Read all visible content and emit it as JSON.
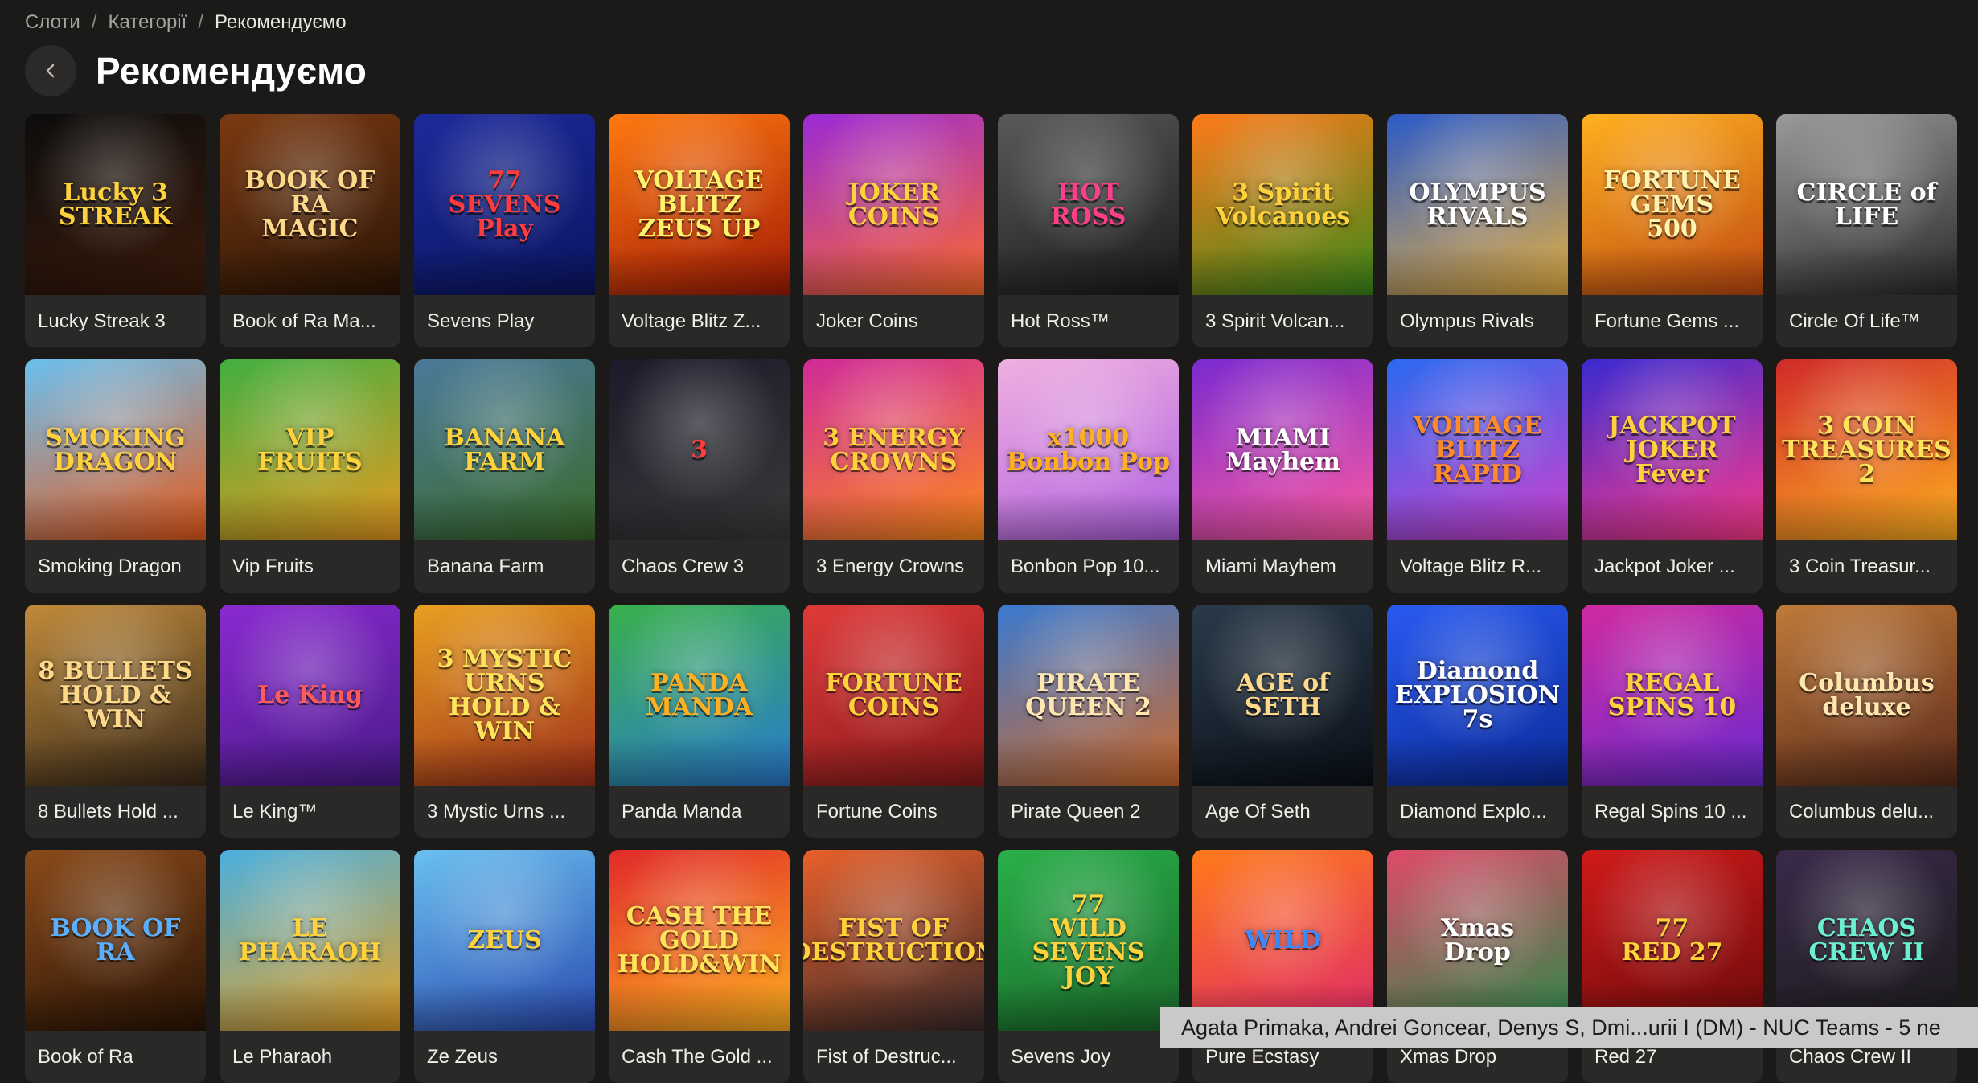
{
  "breadcrumb": {
    "items": [
      "Слоти",
      "Категорії"
    ],
    "separator": "/",
    "current": "Рекомендуємо"
  },
  "header": {
    "title": "Рекомендуємо"
  },
  "games": [
    {
      "title": "Lucky Streak 3",
      "logo": "Lucky 3\nSTREAK",
      "colors": [
        "#0d0d0d",
        "#3a1a0a"
      ],
      "logo_color": "#ffd23b"
    },
    {
      "title": "Book of Ra Ma...",
      "logo": "BOOK OF RA\nMAGIC",
      "colors": [
        "#7b3a12",
        "#2a1405"
      ],
      "logo_color": "#ffd98a"
    },
    {
      "title": "Sevens Play",
      "logo": "77\nSEVENS\nPlay",
      "colors": [
        "#1d2a9c",
        "#0a1560"
      ],
      "logo_color": "#ff3b3b"
    },
    {
      "title": "Voltage Blitz Z...",
      "logo": "VOLTAGE BLITZ\nZEUS UP",
      "colors": [
        "#ff7a10",
        "#a31a05"
      ],
      "logo_color": "#fff36b"
    },
    {
      "title": "Joker Coins",
      "logo": "JOKER\nCOINS",
      "colors": [
        "#9a2ad6",
        "#ff6a2a"
      ],
      "logo_color": "#ffd23b"
    },
    {
      "title": "Hot Ross™",
      "logo": "HOT\nROSS",
      "colors": [
        "#5a5a5a",
        "#1a1a1a"
      ],
      "logo_color": "#ff3d8a"
    },
    {
      "title": "3 Spirit Volcan...",
      "logo": "3 Spirit\nVolcanoes",
      "colors": [
        "#ff7a1a",
        "#3a8a1a"
      ],
      "logo_color": "#ffd23b"
    },
    {
      "title": "Olympus Rivals",
      "logo": "OLYMPUS\nRIVALS",
      "colors": [
        "#2a5ac8",
        "#e8b040"
      ],
      "logo_color": "#ffffff"
    },
    {
      "title": "Fortune Gems ...",
      "logo": "FORTUNE GEMS\n500",
      "colors": [
        "#ffb020",
        "#c04a10"
      ],
      "logo_color": "#fff3b0"
    },
    {
      "title": "Circle Of Life™",
      "logo": "CIRCLE of LIFE",
      "colors": [
        "#9a9a9a",
        "#2a2a2a"
      ],
      "logo_color": "#ffffff"
    },
    {
      "title": "Smoking Dragon",
      "logo": "SMOKING\nDRAGON",
      "colors": [
        "#6ac0f0",
        "#e85a1a"
      ],
      "logo_color": "#ffd23b"
    },
    {
      "title": "Vip Fruits",
      "logo": "VIP\nFRUITS",
      "colors": [
        "#40b040",
        "#e89a20"
      ],
      "logo_color": "#ffd23b"
    },
    {
      "title": "Banana Farm",
      "logo": "BANANA\nFARM",
      "colors": [
        "#4a7a9a",
        "#3a6a2a"
      ],
      "logo_color": "#ffd23b"
    },
    {
      "title": "Chaos Crew 3",
      "logo": "3",
      "colors": [
        "#1a1a2a",
        "#3a3a3a"
      ],
      "logo_color": "#ff3d3d"
    },
    {
      "title": "3 Energy Crowns",
      "logo": "3 ENERGY\nCROWNS",
      "colors": [
        "#d02a9a",
        "#ff8a1a"
      ],
      "logo_color": "#ffd23b"
    },
    {
      "title": "Bonbon Pop 10...",
      "logo": "x1000\nBonbon Pop",
      "colors": [
        "#f0b0e0",
        "#b060e0"
      ],
      "logo_color": "#ffb020"
    },
    {
      "title": "Miami Mayhem",
      "logo": "MIAMI\nMayhem",
      "colors": [
        "#7a2ad0",
        "#ff5aa0"
      ],
      "logo_color": "#ffffff"
    },
    {
      "title": "Voltage Blitz R...",
      "logo": "VOLTAGE BLITZ\nRAPID",
      "colors": [
        "#2a6af0",
        "#d040d0"
      ],
      "logo_color": "#ff8a2a"
    },
    {
      "title": "Jackpot Joker ...",
      "logo": "JACKPOT JOKER\nFever",
      "colors": [
        "#3a2ad0",
        "#ff3a8a"
      ],
      "logo_color": "#ffd23b"
    },
    {
      "title": "3 Coin Treasur...",
      "logo": "3 COIN\nTREASURES 2",
      "colors": [
        "#d02a2a",
        "#ffb020"
      ],
      "logo_color": "#ffe35b"
    },
    {
      "title": "8 Bullets Hold ...",
      "logo": "8 BULLETS\nHOLD & WIN",
      "colors": [
        "#c08a3a",
        "#3a2a1a"
      ],
      "logo_color": "#ffd98a"
    },
    {
      "title": "Le King™",
      "logo": "Le King",
      "colors": [
        "#8a2ad0",
        "#4a1a8a"
      ],
      "logo_color": "#ff5a5a"
    },
    {
      "title": "3 Mystic Urns ...",
      "logo": "3 MYSTIC URNS\nHOLD & WIN",
      "colors": [
        "#e8a020",
        "#a0301a"
      ],
      "logo_color": "#ffe35b"
    },
    {
      "title": "Panda Manda",
      "logo": "PANDA\nMANDA",
      "colors": [
        "#3ab04a",
        "#2a7ad0"
      ],
      "logo_color": "#ffb020"
    },
    {
      "title": "Fortune Coins",
      "logo": "FORTUNE\nCOINS",
      "colors": [
        "#e03a3a",
        "#8a1a1a"
      ],
      "logo_color": "#ffd23b"
    },
    {
      "title": "Pirate Queen 2",
      "logo": "PIRATE\nQUEEN 2",
      "colors": [
        "#3a7ad0",
        "#d06a2a"
      ],
      "logo_color": "#ffe8b0"
    },
    {
      "title": "Age Of Seth",
      "logo": "AGE of\nSETH",
      "colors": [
        "#2a3a4a",
        "#0a1018"
      ],
      "logo_color": "#ffd98a"
    },
    {
      "title": "Diamond Explo...",
      "logo": "Diamond\nEXPLOSION 7s",
      "colors": [
        "#2a5af0",
        "#0a2a9a"
      ],
      "logo_color": "#ffffff"
    },
    {
      "title": "Regal Spins 10 ...",
      "logo": "REGAL\nSPINS 10",
      "colors": [
        "#d02aa0",
        "#6a2ad0"
      ],
      "logo_color": "#ffd23b"
    },
    {
      "title": "Columbus delu...",
      "logo": "Columbus\ndeluxe",
      "colors": [
        "#c07a3a",
        "#5a2a1a"
      ],
      "logo_color": "#ffe8b0"
    },
    {
      "title": "Book of Ra",
      "logo": "BOOK OF RA",
      "colors": [
        "#8a4a1a",
        "#2a1405"
      ],
      "logo_color": "#5ab0ff"
    },
    {
      "title": "Le Pharaoh",
      "logo": "LE PHARAOH",
      "colors": [
        "#4ab0e0",
        "#e8a020"
      ],
      "logo_color": "#ffd23b"
    },
    {
      "title": "Ze Zeus",
      "logo": "ZEUS",
      "colors": [
        "#6ac0f0",
        "#2a4ab0"
      ],
      "logo_color": "#ffd23b"
    },
    {
      "title": "Cash The Gold ...",
      "logo": "CASH THE GOLD\nHOLD&WIN",
      "colors": [
        "#e02a2a",
        "#ffb020"
      ],
      "logo_color": "#ffe35b"
    },
    {
      "title": "Fist of Destruc...",
      "logo": "FIST OF\nDESTRUCTION",
      "colors": [
        "#e8602a",
        "#3a2a2a"
      ],
      "logo_color": "#ffd23b"
    },
    {
      "title": "Sevens Joy",
      "logo": "77\nWILD\nSEVENS JOY",
      "colors": [
        "#2ab04a",
        "#1a6a2a"
      ],
      "logo_color": "#ffd23b"
    },
    {
      "title": "Pure Ecstasy",
      "logo": "WILD",
      "colors": [
        "#ff7a1a",
        "#e02a6a"
      ],
      "logo_color": "#3a8aff"
    },
    {
      "title": "Xmas Drop",
      "logo": "Xmas\nDrop",
      "colors": [
        "#e04a6a",
        "#2a8a4a"
      ],
      "logo_color": "#ffffff"
    },
    {
      "title": "Red 27",
      "logo": "77\nRED 27",
      "colors": [
        "#d01a1a",
        "#6a0a0a"
      ],
      "logo_color": "#ffd23b"
    },
    {
      "title": "Chaos Crew II",
      "logo": "CHAOS\nCREW II",
      "colors": [
        "#3a2a4a",
        "#1a1a1a"
      ],
      "logo_color": "#6af0d0"
    }
  ],
  "tooltip": {
    "text": "Agata Primaka, Andrei Goncear, Denys S, Dmi...urii I (DM) - NUC Teams - 5 ne"
  },
  "icons": {
    "back": "chevron-left-icon"
  },
  "colors": {
    "background": "#1b1a19",
    "card": "#2a2928",
    "back_button": "#2b2a29",
    "tooltip_bg": "#c9c9c9"
  }
}
